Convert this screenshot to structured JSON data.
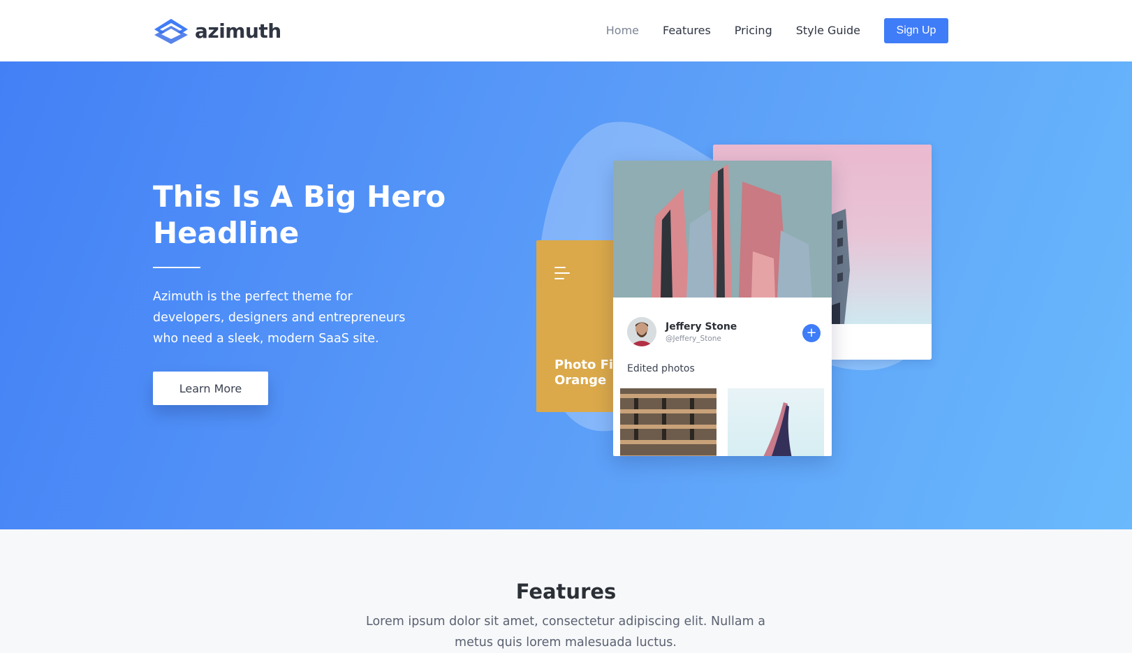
{
  "nav": {
    "brand": "azimuth",
    "links": [
      {
        "label": "Home",
        "active": true
      },
      {
        "label": "Features",
        "active": false
      },
      {
        "label": "Pricing",
        "active": false
      },
      {
        "label": "Style Guide",
        "active": false
      }
    ],
    "signup_label": "Sign Up"
  },
  "hero": {
    "title": "This Is A Big Hero Headline",
    "subtitle": "Azimuth is the perfect theme for developers, designers and entrepreneurs who need a sleek, modern SaaS site.",
    "cta_label": "Learn More",
    "card_orange_label": "Photo Filter Orange",
    "profile": {
      "name": "Jeffery Stone",
      "handle": "@Jeffery_Stone",
      "section": "Edited photos",
      "add_label": "+"
    }
  },
  "features": {
    "title": "Features",
    "subtitle": "Lorem ipsum dolor sit amet, consectetur adipiscing elit. Nullam a metus quis lorem malesuada luctus."
  },
  "colors": {
    "accent": "#3f7cf7",
    "hero_start": "#4380f6",
    "hero_end": "#6ab9fc",
    "orange_card": "#dba94a"
  },
  "icons": [
    "azimuth-logo-icon",
    "menu-lines-icon",
    "plus-icon"
  ]
}
